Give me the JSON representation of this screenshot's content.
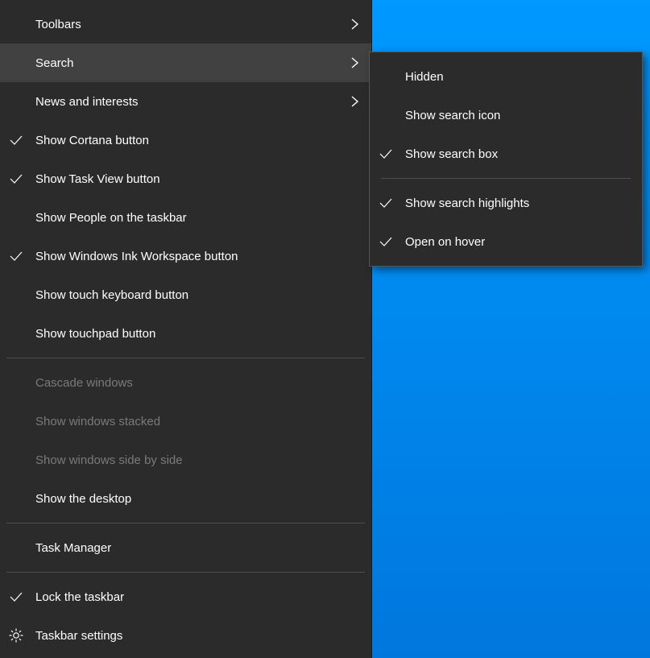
{
  "main_menu": {
    "items": [
      {
        "label": "Toolbars",
        "has_submenu": true,
        "checked": false,
        "disabled": false,
        "icon": null
      },
      {
        "label": "Search",
        "has_submenu": true,
        "checked": false,
        "disabled": false,
        "highlighted": true,
        "icon": null
      },
      {
        "label": "News and interests",
        "has_submenu": true,
        "checked": false,
        "disabled": false,
        "icon": null
      },
      {
        "label": "Show Cortana button",
        "has_submenu": false,
        "checked": true,
        "disabled": false,
        "icon": null
      },
      {
        "label": "Show Task View button",
        "has_submenu": false,
        "checked": true,
        "disabled": false,
        "icon": null
      },
      {
        "label": "Show People on the taskbar",
        "has_submenu": false,
        "checked": false,
        "disabled": false,
        "icon": null
      },
      {
        "label": "Show Windows Ink Workspace button",
        "has_submenu": false,
        "checked": true,
        "disabled": false,
        "icon": null
      },
      {
        "label": "Show touch keyboard button",
        "has_submenu": false,
        "checked": false,
        "disabled": false,
        "icon": null
      },
      {
        "label": "Show touchpad button",
        "has_submenu": false,
        "checked": false,
        "disabled": false,
        "icon": null
      },
      {
        "separator": true
      },
      {
        "label": "Cascade windows",
        "has_submenu": false,
        "checked": false,
        "disabled": true,
        "icon": null
      },
      {
        "label": "Show windows stacked",
        "has_submenu": false,
        "checked": false,
        "disabled": true,
        "icon": null
      },
      {
        "label": "Show windows side by side",
        "has_submenu": false,
        "checked": false,
        "disabled": true,
        "icon": null
      },
      {
        "label": "Show the desktop",
        "has_submenu": false,
        "checked": false,
        "disabled": false,
        "icon": null
      },
      {
        "separator": true
      },
      {
        "label": "Task Manager",
        "has_submenu": false,
        "checked": false,
        "disabled": false,
        "icon": null
      },
      {
        "separator": true
      },
      {
        "label": "Lock the taskbar",
        "has_submenu": false,
        "checked": true,
        "disabled": false,
        "icon": null
      },
      {
        "label": "Taskbar settings",
        "has_submenu": false,
        "checked": false,
        "disabled": false,
        "icon": "gear"
      }
    ]
  },
  "submenu": {
    "items": [
      {
        "label": "Hidden",
        "checked": false
      },
      {
        "label": "Show search icon",
        "checked": false
      },
      {
        "label": "Show search box",
        "checked": true
      },
      {
        "separator": true
      },
      {
        "label": "Show search highlights",
        "checked": true
      },
      {
        "label": "Open on hover",
        "checked": true
      }
    ]
  }
}
